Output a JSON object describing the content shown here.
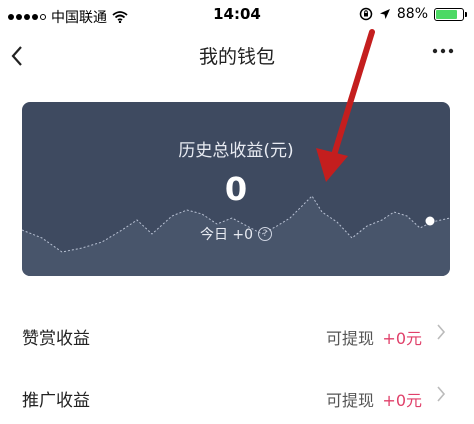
{
  "statusbar": {
    "carrier": "中国联通",
    "time": "14:04",
    "battery": "88%",
    "battery_level": 0.88
  },
  "nav": {
    "back_icon": "chevron-left-icon",
    "title": "我的钱包",
    "more_icon": "more-horizontal-icon"
  },
  "card": {
    "title": "历史总收益(元)",
    "amount": "0",
    "today": "今日 +0",
    "help_icon": "question-circle-icon",
    "background": "#3e4a60"
  },
  "rows": [
    {
      "label": "赞赏收益",
      "status": "可提现",
      "amount": "+0元"
    },
    {
      "label": "推广收益",
      "status": "可提现",
      "amount": "+0元"
    }
  ],
  "colors": {
    "accent_amount": "#e0406a",
    "annotation_arrow": "#c41e1e"
  }
}
